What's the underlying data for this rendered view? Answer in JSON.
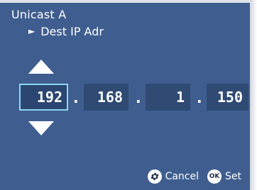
{
  "header": {
    "title": "Unicast A",
    "subtitle_marker": "►",
    "subtitle": "Dest IP Adr"
  },
  "ip": {
    "octets": [
      "192",
      "168",
      "1",
      "150"
    ],
    "separator": ".",
    "selected_index": 0
  },
  "footer": {
    "cancel_label": "Cancel",
    "set_label": "Set",
    "ok_badge": "OK"
  },
  "colors": {
    "background": "#3f5e8f",
    "field": "#2f4a73",
    "selected_border": "#8fd6f2",
    "text": "#ffffff"
  },
  "icons": {
    "increment": "triangle-up-icon",
    "decrement": "triangle-down-icon",
    "cancel": "gear-icon",
    "set": "ok-badge-icon"
  }
}
